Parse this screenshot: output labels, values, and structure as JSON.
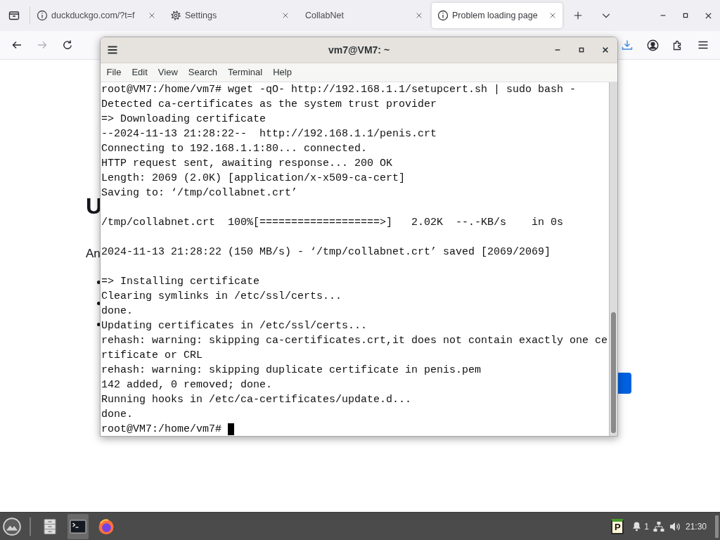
{
  "browser": {
    "tabs": [
      {
        "kind": "info",
        "title": "duckduckgo.com/?t=f",
        "selected": false
      },
      {
        "kind": "settings",
        "title": "Settings",
        "selected": false
      },
      {
        "kind": "plain",
        "title": "CollabNet",
        "selected": false
      },
      {
        "kind": "info",
        "title": "Problem loading page",
        "selected": true
      }
    ],
    "nav_buttons": [
      {
        "kind": "back",
        "disabled": false
      },
      {
        "kind": "forward",
        "disabled": true
      },
      {
        "kind": "reload",
        "disabled": false
      }
    ],
    "page": {
      "heading": "U",
      "paragraph": "An"
    }
  },
  "terminal": {
    "title": "vm7@VM7: ~",
    "menu": [
      "File",
      "Edit",
      "View",
      "Search",
      "Terminal",
      "Help"
    ],
    "lines": [
      {
        "kind": "prompt",
        "text": "root@VM7:/home/vm7# wget -qO- http://192.168.1.1/setupcert.sh | sudo bash -",
        "cursor": false
      },
      {
        "kind": "text",
        "text": "Detected ca-certificates as the system trust provider"
      },
      {
        "kind": "text",
        "text": "=> Downloading certificate"
      },
      {
        "kind": "text",
        "text": "--2024-11-13 21:28:22--  http://192.168.1.1/penis.crt"
      },
      {
        "kind": "text",
        "text": "Connecting to 192.168.1.1:80... connected."
      },
      {
        "kind": "text",
        "text": "HTTP request sent, awaiting response... 200 OK"
      },
      {
        "kind": "text",
        "text": "Length: 2069 (2.0K) [application/x-x509-ca-cert]"
      },
      {
        "kind": "text",
        "text": "Saving to: ‘/tmp/collabnet.crt’"
      },
      {
        "kind": "blank"
      },
      {
        "kind": "text",
        "text": "/tmp/collabnet.crt  100%[===================>]   2.02K  --.-KB/s    in 0s"
      },
      {
        "kind": "blank"
      },
      {
        "kind": "text",
        "text": "2024-11-13 21:28:22 (150 MB/s) - ‘/tmp/collabnet.crt’ saved [2069/2069]"
      },
      {
        "kind": "blank"
      },
      {
        "kind": "text",
        "text": "=> Installing certificate"
      },
      {
        "kind": "text",
        "text": "Clearing symlinks in /etc/ssl/certs..."
      },
      {
        "kind": "text",
        "text": "done."
      },
      {
        "kind": "text",
        "text": "Updating certificates in /etc/ssl/certs..."
      },
      {
        "kind": "text",
        "text": "rehash: warning: skipping ca-certificates.crt,it does not contain exactly one ce"
      },
      {
        "kind": "text",
        "text": "rtificate or CRL"
      },
      {
        "kind": "text",
        "text": "rehash: warning: skipping duplicate certificate in penis.pem"
      },
      {
        "kind": "text",
        "text": "142 added, 0 removed; done."
      },
      {
        "kind": "text",
        "text": "Running hooks in /etc/ca-certificates/update.d..."
      },
      {
        "kind": "text",
        "text": "done."
      },
      {
        "kind": "prompt",
        "text": "root@VM7:/home/vm7#",
        "cursor": true
      }
    ]
  },
  "taskbar": {
    "launchers": [
      {
        "kind": "files",
        "active": false
      },
      {
        "kind": "terminal",
        "active": true
      },
      {
        "kind": "browser",
        "active": false
      }
    ],
    "tray": {
      "clipboard": "P",
      "notification_count": "1",
      "clock": "21:30"
    }
  }
}
